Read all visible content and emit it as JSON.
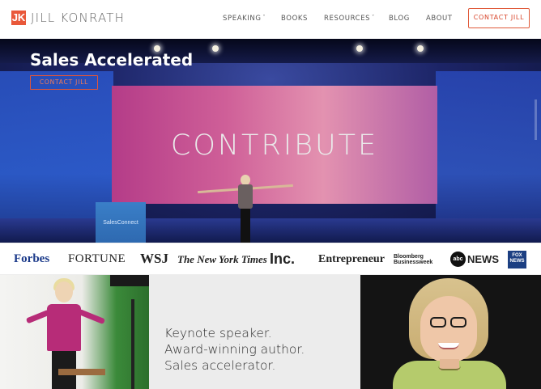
{
  "brand": {
    "mark": "JK",
    "name": "JILL KONRATH",
    "accent": "#e9583a"
  },
  "nav": {
    "items": [
      {
        "label": "SPEAKING",
        "caret": "˅"
      },
      {
        "label": "BOOKS"
      },
      {
        "label": "RESOURCES",
        "caret": "˅"
      },
      {
        "label": "BLOG"
      },
      {
        "label": "ABOUT"
      }
    ],
    "cta": "CONTACT JILL"
  },
  "hero": {
    "title": "Sales Accelerated",
    "button": "CONTACT JILL",
    "screen_text": "CONTRIBUTE",
    "podium_text": "SalesConnect"
  },
  "press": {
    "forbes": "Forbes",
    "fortune": "FORTUNE",
    "wsj": "WSJ",
    "nyt": "The New York Times",
    "inc": "Inc.",
    "entrepreneur": "Entrepreneur",
    "bloomberg": "Bloomberg Businessweek",
    "abc_icon": "abc",
    "abc_text": "NEWS",
    "fox": "FOX NEWS"
  },
  "tagline": {
    "line1": "Keynote speaker.",
    "line2": "Award-winning author.",
    "line3": "Sales accelerator."
  }
}
